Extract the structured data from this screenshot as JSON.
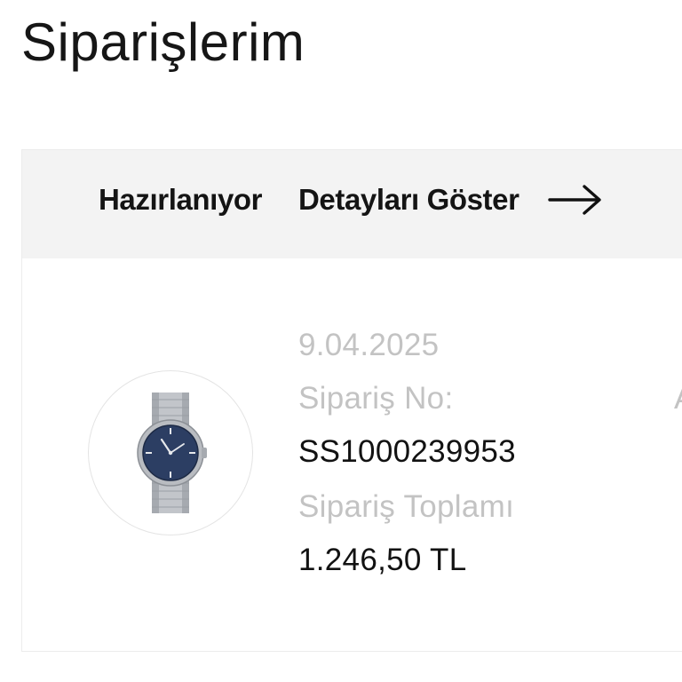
{
  "header": {
    "title": "Siparişlerim"
  },
  "order": {
    "status": "Hazırlanıyor",
    "details_label": "Detayları Göster",
    "date": "9.04.2025",
    "order_no_label": "Sipariş No:",
    "order_no": "SS1000239953",
    "total_label": "Sipariş Toplamı",
    "total": "1.246,50 TL",
    "edge_glyph": "A"
  },
  "icons": {
    "details_arrow": "arrow-right-icon",
    "product_image": "watch-icon"
  },
  "colors": {
    "header_bg": "#f3f3f3",
    "muted_text": "#c3c3c3",
    "primary_text": "#121212",
    "watch_dial": "#2c3e63",
    "watch_steel": "#b9bcc1"
  }
}
